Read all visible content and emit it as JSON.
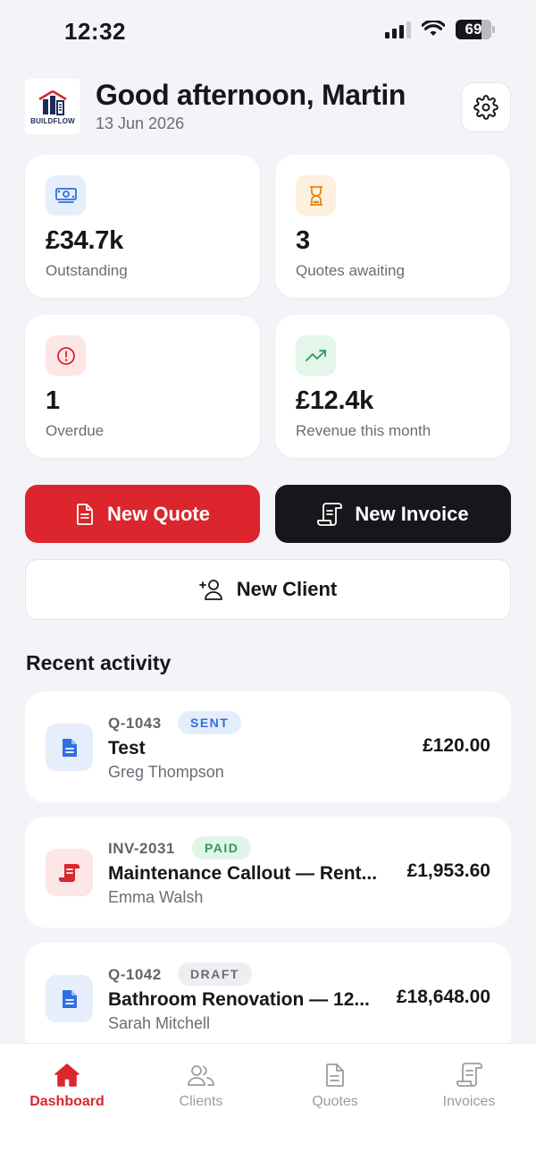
{
  "status_bar": {
    "time": "12:32",
    "battery": "69"
  },
  "header": {
    "logo_text": "BUILDFLOW",
    "greeting": "Good afternoon, Martin",
    "date": "13 Jun 2026"
  },
  "stats": [
    {
      "value": "£34.7k",
      "label": "Outstanding",
      "icon": "cash-icon",
      "color": "#2f6fe0",
      "bg": "#e6eefc"
    },
    {
      "value": "3",
      "label": "Quotes awaiting",
      "icon": "hourglass-icon",
      "color": "#e38a12",
      "bg": "#fdf0de"
    },
    {
      "value": "1",
      "label": "Overdue",
      "icon": "alert-circle-icon",
      "color": "#dc252c",
      "bg": "#fde6e6"
    },
    {
      "value": "£12.4k",
      "label": "Revenue this month",
      "icon": "trending-up-icon",
      "color": "#2e9a55",
      "bg": "#e4f5ea"
    }
  ],
  "actions": {
    "new_quote": "New Quote",
    "new_invoice": "New Invoice",
    "new_client": "New Client"
  },
  "recent_activity": {
    "title": "Recent activity",
    "items": [
      {
        "ref": "Q-1043",
        "status": "SENT",
        "title": "Test",
        "client": "Greg Thompson",
        "amount": "£120.00",
        "type": "quote"
      },
      {
        "ref": "INV-2031",
        "status": "PAID",
        "title": "Maintenance Callout — Rent...",
        "client": "Emma Walsh",
        "amount": "£1,953.60",
        "type": "invoice"
      },
      {
        "ref": "Q-1042",
        "status": "DRAFT",
        "title": "Bathroom Renovation — 12...",
        "client": "Sarah Mitchell",
        "amount": "£18,648.00",
        "type": "quote"
      }
    ]
  },
  "tabs": [
    {
      "label": "Dashboard",
      "icon": "home-icon",
      "active": true
    },
    {
      "label": "Clients",
      "icon": "users-icon",
      "active": false
    },
    {
      "label": "Quotes",
      "icon": "document-icon",
      "active": false
    },
    {
      "label": "Invoices",
      "icon": "receipt-icon",
      "active": false
    }
  ],
  "colors": {
    "accent": "#dc252c",
    "dark": "#16171b",
    "sent_badge_bg": "#e4edfc",
    "sent_badge_fg": "#2f6fe0",
    "paid_badge_bg": "#e2f4e8",
    "paid_badge_fg": "#2e9a55",
    "draft_badge_bg": "#eceef1",
    "draft_badge_fg": "#6a6d75"
  }
}
